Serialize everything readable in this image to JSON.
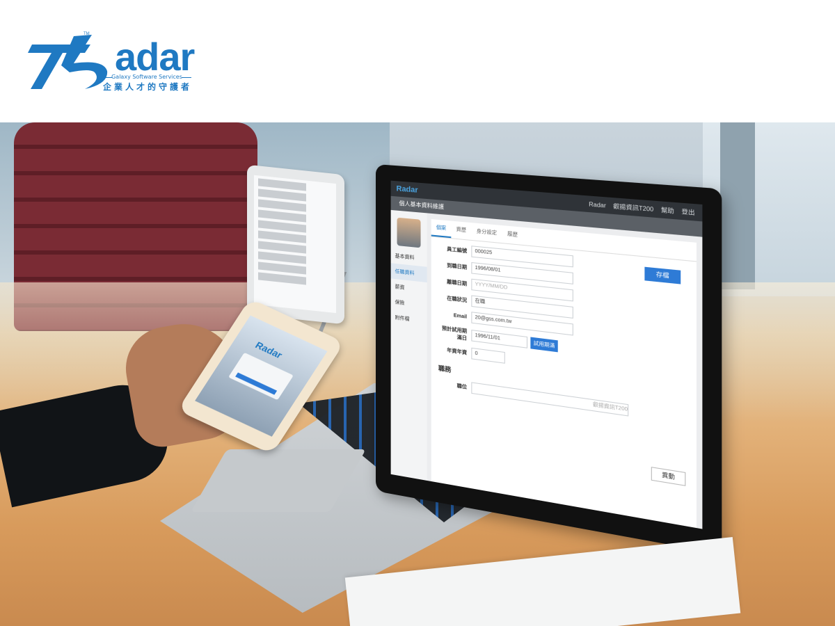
{
  "logo": {
    "wordmark": "adar",
    "tm": "TM",
    "subtitle": "Galaxy Software Services",
    "tagline": "企業人才的守護者",
    "brand_color": "#1f79c2"
  },
  "laptop_app": {
    "brand": "Radar",
    "topbar": {
      "user_label": "Radar",
      "company": "叡揚資訊T200",
      "help": "幫助",
      "logout": "登出"
    },
    "page_title": "個人基本資料維護",
    "sidebar": {
      "items": [
        "基本資料",
        "任職資料",
        "薪資",
        "保險",
        "附件檔"
      ]
    },
    "tabs": [
      "個案",
      "資歷",
      "身分設定",
      "履歷"
    ],
    "fields": [
      {
        "label": "員工編號",
        "value": "000025"
      },
      {
        "label": "到職日期",
        "value": "1996/08/01"
      },
      {
        "label": "離職日期",
        "value": "YYYY/MM/DD"
      },
      {
        "label": "在職狀況",
        "value": "在職"
      },
      {
        "label": "Email",
        "value": "20@gss.com.tw"
      },
      {
        "label": "預計試用期滿日",
        "value": "1996/11/01"
      },
      {
        "label": "年資年資",
        "value": "0"
      }
    ],
    "save_button": "存檔",
    "trial_button": "試用期滿",
    "section_title": "職務",
    "position_label": "職位",
    "company_name": "叡揚資訊T200",
    "edit_button": "異動"
  },
  "phone_app": {
    "brand": "Radar"
  }
}
